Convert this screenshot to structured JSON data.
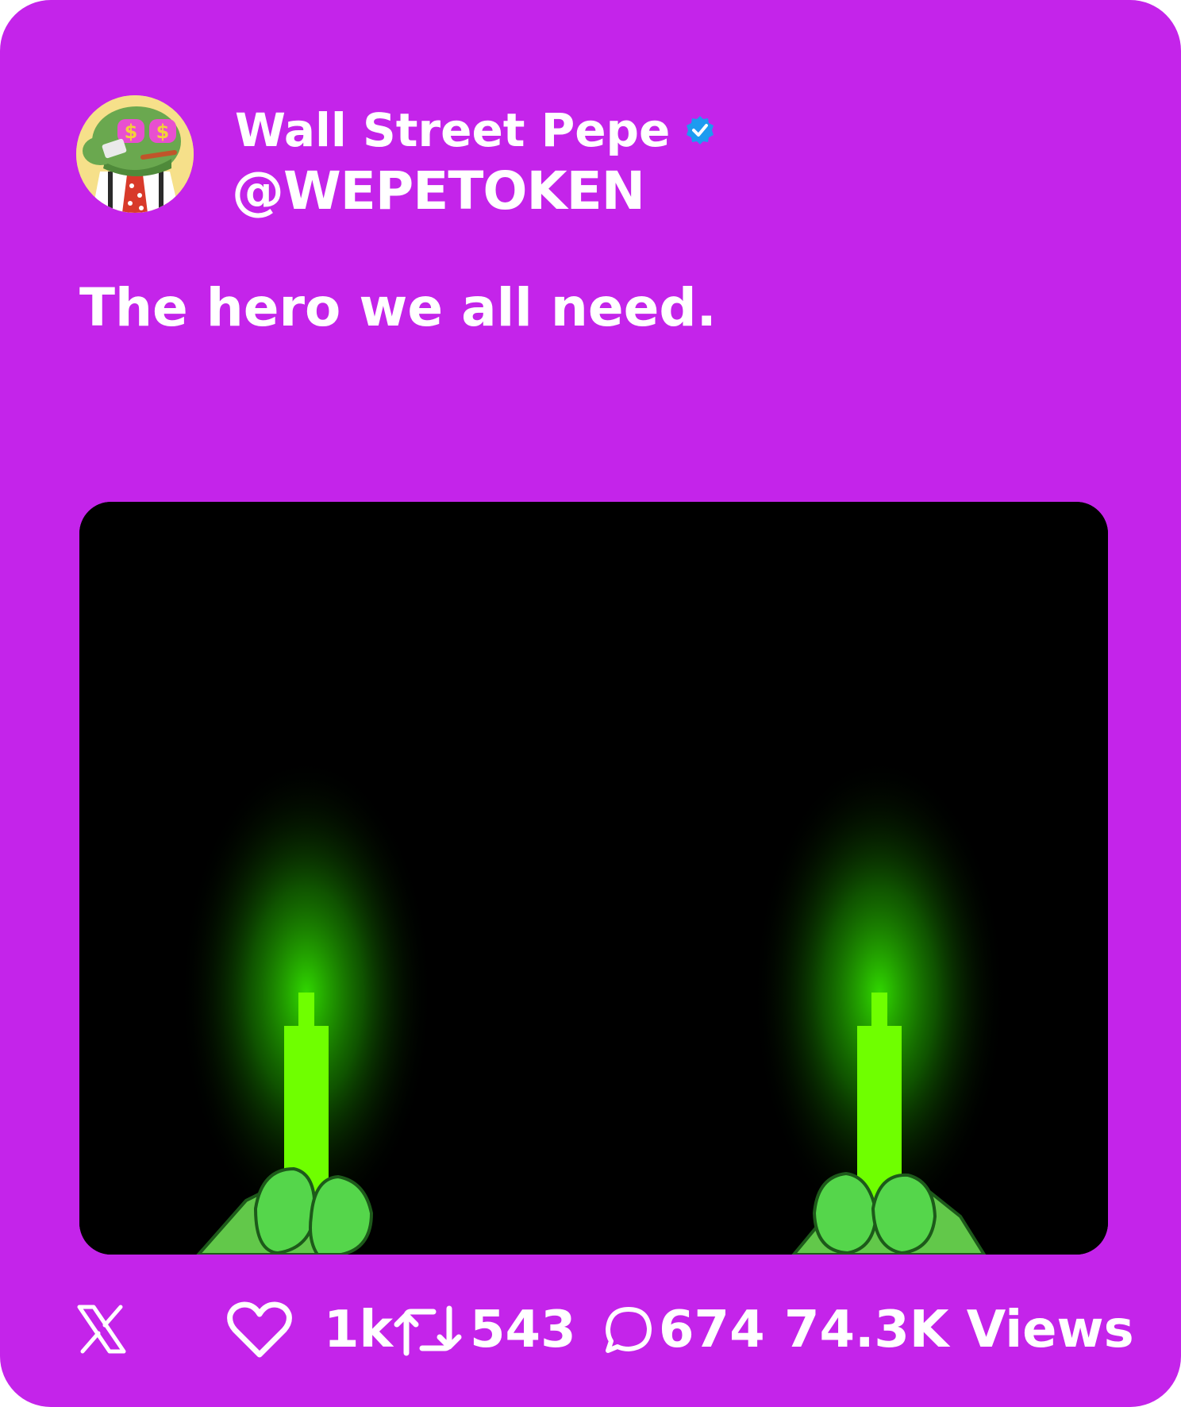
{
  "post": {
    "author_name": "Wall Street Pepe",
    "author_handle": "@WEPETOKEN",
    "verified": true,
    "text": "The hero we all need."
  },
  "media": {
    "type": "image",
    "description_icons": [
      "hand-left-icon",
      "hand-right-icon",
      "green-candle-icon"
    ]
  },
  "stats": {
    "likes": "1k",
    "reposts": "543",
    "replies": "674",
    "views": "74.3K Views"
  },
  "colors": {
    "card_bg": "#c424ea",
    "media_bg": "#000000",
    "candle_green": "#6fff00",
    "verified_blue": "#1d9bf0",
    "text": "#ffffff"
  }
}
